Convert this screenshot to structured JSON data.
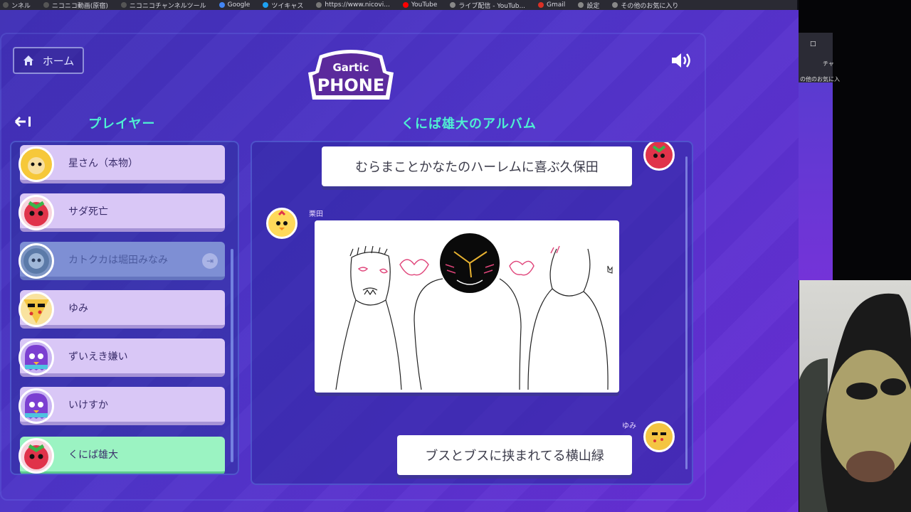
{
  "browser": {
    "bookmarks": [
      {
        "label": "ンネル",
        "color": "#555"
      },
      {
        "label": "ニコニコ動画(原宿)",
        "color": "#555"
      },
      {
        "label": "ニコニコチャンネルツール",
        "color": "#555"
      },
      {
        "label": "Google",
        "color": "#4285f4"
      },
      {
        "label": "ツイキャス",
        "color": "#1da1f2"
      },
      {
        "label": "https://www.nicovi...",
        "color": "#777"
      },
      {
        "label": "YouTube",
        "color": "#ff0000"
      },
      {
        "label": "ライブ配信 - YouTub...",
        "color": "#888"
      },
      {
        "label": "Gmail",
        "color": "#d93025"
      },
      {
        "label": "設定",
        "color": "#888"
      },
      {
        "label": "その他のお気に入り",
        "color": "#888"
      }
    ]
  },
  "header": {
    "home_label": "ホーム",
    "logo_top": "Gartic",
    "logo_bottom": "PHONE"
  },
  "players_panel": {
    "title": "プレイヤー",
    "players": [
      {
        "name": "星さん（本物）",
        "avatar": "sunflower-avatar",
        "state": "normal"
      },
      {
        "name": "サダ死亡",
        "avatar": "strawberry-avatar",
        "state": "normal"
      },
      {
        "name": "カトクカは堀田みなみ",
        "avatar": "robot-avatar",
        "state": "left"
      },
      {
        "name": "ゆみ",
        "avatar": "pizza-avatar",
        "state": "normal"
      },
      {
        "name": "ずいえき嫌い",
        "avatar": "ghost-avatar",
        "state": "normal"
      },
      {
        "name": "いけすか",
        "avatar": "ghost-avatar",
        "state": "normal"
      },
      {
        "name": "くにば雄大",
        "avatar": "strawberry-avatar",
        "state": "active"
      }
    ]
  },
  "album": {
    "title": "くにば雄大のアルバム",
    "entries": [
      {
        "type": "text",
        "text": "むらまことかなたのハーレムに喜ぶ久保田"
      },
      {
        "type": "drawing",
        "author": "栗田"
      },
      {
        "type": "text",
        "text": "ブスとブスに挟まれてる横山緑",
        "author": "ゆみ"
      }
    ]
  },
  "side": {
    "tab_text": "チャ",
    "folder_text": "の他のお気に入"
  },
  "colors": {
    "accent": "#4ff0d2",
    "active_player": "#9bf3c2",
    "player_card": "#d9c7f6"
  }
}
